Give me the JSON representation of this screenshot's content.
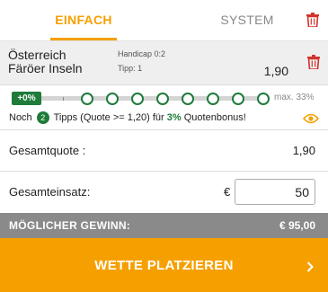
{
  "tabs": {
    "single": "EINFACH",
    "system": "SYSTEM"
  },
  "bet": {
    "team1": "Österreich",
    "team2": "Färöer Inseln",
    "market": "Handicap 0:2",
    "tip": "Tipp: 1",
    "odd": "1,90"
  },
  "bonus": {
    "start_label": "+0%",
    "max_label": "max. 33%",
    "progress": 0,
    "steps": 8,
    "info_pre": "Noch",
    "tips_needed": "2",
    "info_mid": "Tipps (Quote >= 1,20) für",
    "bonus_percent": "3%",
    "info_post": "Quotenbonus!"
  },
  "summary": {
    "total_odds_label": "Gesamtquote :",
    "total_odds_value": "1,90",
    "stake_label": "Gesamteinsatz:",
    "currency": "€",
    "stake_value": "50",
    "win_label": "MÖGLICHER GEWINN:",
    "win_value": "€ 95,00"
  },
  "action": {
    "place_label": "WETTE PLATZIEREN"
  },
  "colors": {
    "accent": "#f5a000",
    "green": "#1e7b3a",
    "win_bar": "#8a8a8a",
    "delete": "#d0342c"
  }
}
